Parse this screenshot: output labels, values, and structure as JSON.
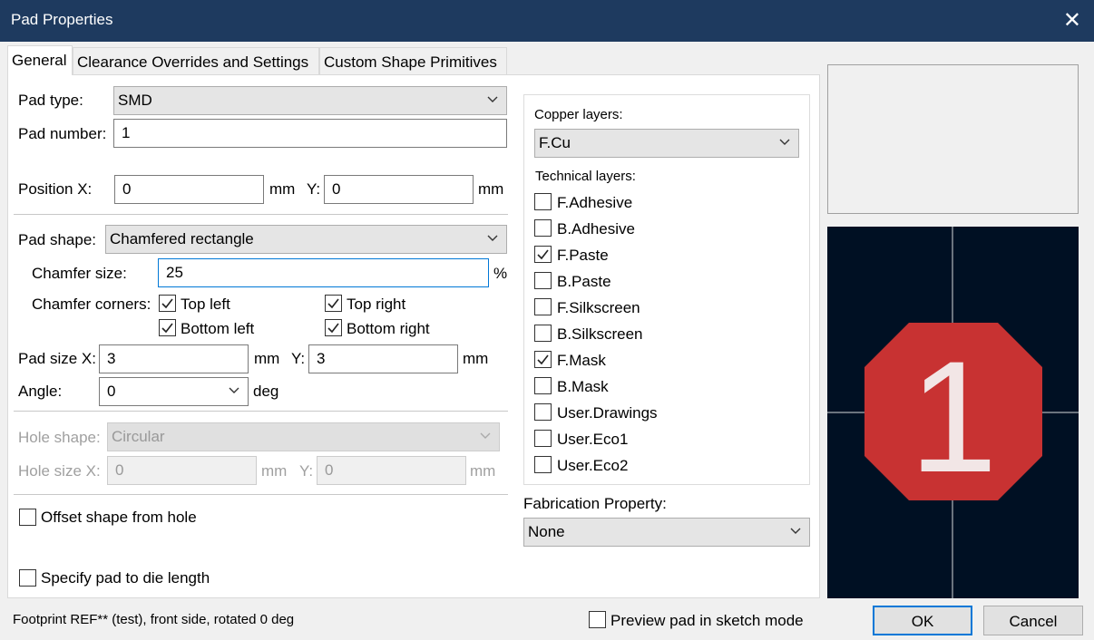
{
  "window": {
    "title": "Pad Properties"
  },
  "tabs": [
    {
      "label": "General"
    },
    {
      "label": "Clearance Overrides and Settings"
    },
    {
      "label": "Custom Shape Primitives"
    }
  ],
  "general": {
    "pad_type_label": "Pad type:",
    "pad_type_value": "SMD",
    "pad_number_label": "Pad number:",
    "pad_number_value": "1",
    "position_x_label": "Position X:",
    "position_x_value": "0",
    "position_x_unit": "mm",
    "position_y_label": "Y:",
    "position_y_value": "0",
    "position_y_unit": "mm",
    "pad_shape_label": "Pad shape:",
    "pad_shape_value": "Chamfered rectangle",
    "chamfer_size_label": "Chamfer size:",
    "chamfer_size_value": "25",
    "chamfer_size_unit": "%",
    "chamfer_corners_label": "Chamfer corners:",
    "corners": {
      "top_left": {
        "label": "Top left",
        "checked": true
      },
      "top_right": {
        "label": "Top right",
        "checked": true
      },
      "bottom_left": {
        "label": "Bottom left",
        "checked": true
      },
      "bottom_right": {
        "label": "Bottom right",
        "checked": true
      }
    },
    "pad_size_x_label": "Pad size X:",
    "pad_size_x_value": "3",
    "pad_size_x_unit": "mm",
    "pad_size_y_label": "Y:",
    "pad_size_y_value": "3",
    "pad_size_y_unit": "mm",
    "angle_label": "Angle:",
    "angle_value": "0",
    "angle_unit": "deg",
    "hole_shape_label": "Hole shape:",
    "hole_shape_value": "Circular",
    "hole_size_x_label": "Hole size X:",
    "hole_size_x_value": "0",
    "hole_size_x_unit": "mm",
    "hole_size_y_label": "Y:",
    "hole_size_y_value": "0",
    "hole_size_y_unit": "mm",
    "offset_shape_label": "Offset shape from hole",
    "die_length_label": "Specify pad to die length"
  },
  "layers": {
    "copper_label": "Copper layers:",
    "copper_value": "F.Cu",
    "technical_label": "Technical layers:",
    "items": [
      {
        "label": "F.Adhesive",
        "checked": false
      },
      {
        "label": "B.Adhesive",
        "checked": false
      },
      {
        "label": "F.Paste",
        "checked": true
      },
      {
        "label": "B.Paste",
        "checked": false
      },
      {
        "label": "F.Silkscreen",
        "checked": false
      },
      {
        "label": "B.Silkscreen",
        "checked": false
      },
      {
        "label": "F.Mask",
        "checked": true
      },
      {
        "label": "B.Mask",
        "checked": false
      },
      {
        "label": "User.Drawings",
        "checked": false
      },
      {
        "label": "User.Eco1",
        "checked": false
      },
      {
        "label": "User.Eco2",
        "checked": false
      }
    ]
  },
  "fabrication": {
    "label": "Fabrication Property:",
    "value": "None"
  },
  "preview": {
    "pad_number": "1",
    "pad_color": "#c83232",
    "background": "#001023",
    "number_color": "#f2e6e6"
  },
  "footer": {
    "status": "Footprint REF** (test), front side, rotated 0 deg",
    "sketch_mode_label": "Preview pad in sketch mode",
    "ok_label": "OK",
    "cancel_label": "Cancel"
  }
}
